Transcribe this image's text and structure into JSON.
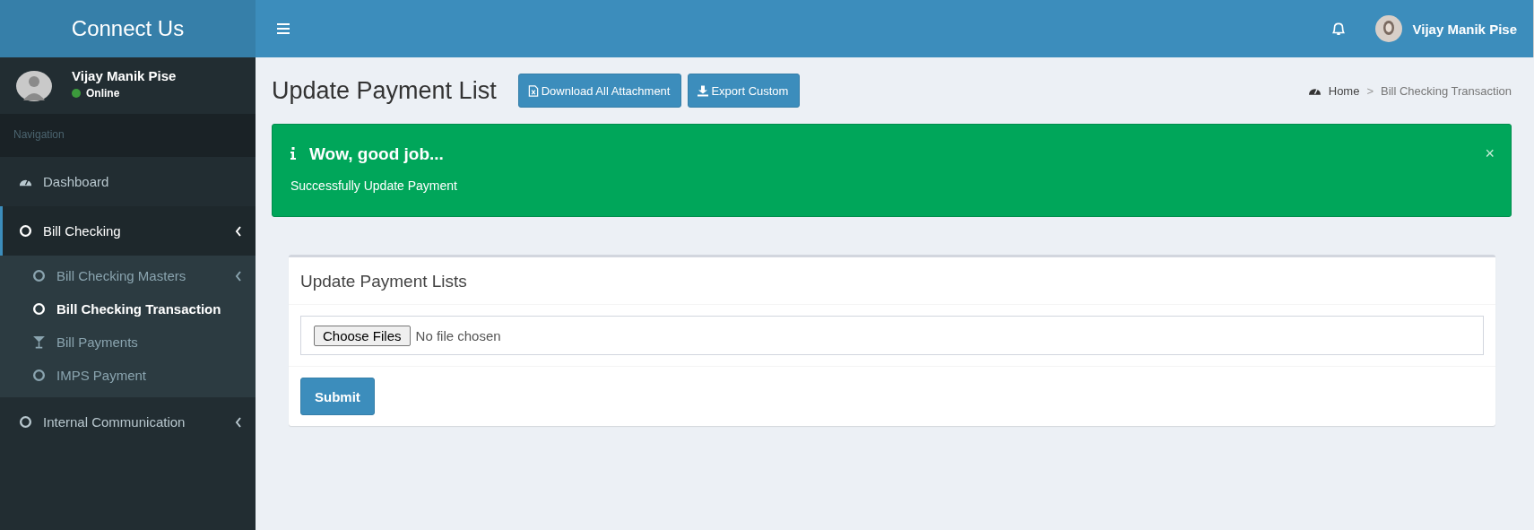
{
  "brand": "Connect Us",
  "user": {
    "name": "Vijay Manik Pise",
    "status": "Online"
  },
  "sidebar": {
    "header": "Navigation",
    "items": [
      {
        "label": "Dashboard",
        "kind": "gauge",
        "selected": false
      },
      {
        "label": "Bill Checking",
        "kind": "circle",
        "selected": true,
        "expanded": true,
        "children": [
          {
            "label": "Bill Checking Masters",
            "kind": "circle",
            "selected": false,
            "expanded": false
          },
          {
            "label": "Bill Checking Transaction",
            "kind": "circle",
            "selected": true
          },
          {
            "label": "Bill Payments",
            "kind": "glass",
            "selected": false
          },
          {
            "label": "IMPS Payment",
            "kind": "circle",
            "selected": false
          }
        ]
      },
      {
        "label": "Internal Communication",
        "kind": "circle",
        "selected": false,
        "expanded": false
      }
    ]
  },
  "topbar": {
    "user_name": "Vijay Manik Pise"
  },
  "page": {
    "title": "Update Payment List",
    "buttons": [
      {
        "label": "Download All Attachment",
        "kind": "file"
      },
      {
        "label": "Export Custom",
        "kind": "download"
      }
    ],
    "breadcrumb": [
      "Home",
      "Bill Checking Transaction"
    ],
    "breadcrumb_separator": ">"
  },
  "alert": {
    "title": "Wow, good job...",
    "message": "Successfully Update Payment",
    "close": "×"
  },
  "form": {
    "title": "Update Payment Lists",
    "file_button": "Choose Files",
    "file_status": "No file chosen",
    "submit": "Submit"
  }
}
